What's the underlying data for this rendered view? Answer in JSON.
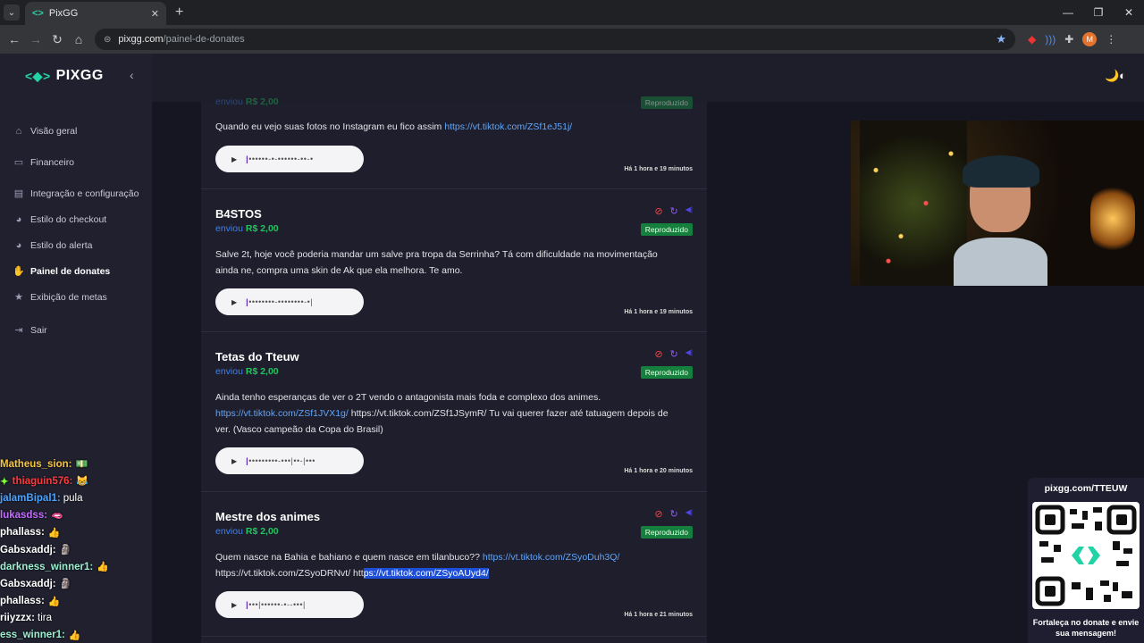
{
  "browser": {
    "tab_title": "PixGG",
    "url_domain": "pixgg.com",
    "url_path": "/painel-de-donates",
    "profile_initial": "M"
  },
  "sidebar": {
    "logo": "PIXGG",
    "items": [
      {
        "label": "Visão geral",
        "icon": "home-icon"
      },
      {
        "label": "Financeiro",
        "icon": "wallet-icon"
      },
      {
        "label": "Integração e configuração",
        "icon": "settings-icon"
      },
      {
        "label": "Estilo do checkout",
        "icon": "palette-icon"
      },
      {
        "label": "Estilo do alerta",
        "icon": "palette-icon"
      },
      {
        "label": "Painel de donates",
        "icon": "donate-icon",
        "active": true
      },
      {
        "label": "Exibição de metas",
        "icon": "star-icon"
      },
      {
        "label": "Sair",
        "icon": "logout-icon"
      }
    ]
  },
  "donations": [
    {
      "name": "",
      "sent_label": "enviou",
      "amount": "R$ 2,00",
      "message_parts": [
        {
          "text": "Quando eu vejo suas fotos no Instagram eu fico assim "
        },
        {
          "link": "https://vt.tiktok.com/ZSf1eJ51j/"
        }
      ],
      "time": "Há 1 hora e 19 minutos",
      "status": "Reproduzido"
    },
    {
      "name": "B4STOS",
      "sent_label": "enviou",
      "amount": "R$ 2,00",
      "message_parts": [
        {
          "text": "Salve 2t, hoje você poderia mandar um salve pra tropa da Serrinha? Tá com dificuldade na movimentação ainda ne, compra uma skin de Ak que ela melhora. Te amo."
        }
      ],
      "time": "Há 1 hora e 19 minutos",
      "status": "Reproduzido"
    },
    {
      "name": "Tetas do Tteuw",
      "sent_label": "enviou",
      "amount": "R$ 2,00",
      "message_parts": [
        {
          "text": "Ainda tenho esperanças de ver o 2T vendo o antagonista mais foda e complexo dos animes. "
        },
        {
          "link": "https://vt.tiktok.com/ZSf1JVX1g/"
        },
        {
          "text": " https://vt.tiktok.com/ZSf1JSymR/ Tu vai querer fazer até tatuagem depois de ver. (Vasco campeão da Copa do Brasil)"
        }
      ],
      "time": "Há 1 hora e 20 minutos",
      "status": "Reproduzido"
    },
    {
      "name": "Mestre dos animes",
      "sent_label": "enviou",
      "amount": "R$ 2,00",
      "message_parts": [
        {
          "text": "Quem nasce na Bahia e bahiano e quem nasce em tilanbuco?? "
        },
        {
          "link": "https://vt.tiktok.com/ZSyoDuh3Q/"
        },
        {
          "text": " https://vt.tiktok.com/ZSyoDRNvt/ htt"
        },
        {
          "sel": "ps://vt.tiktok.com/ZSyoAUyd4/"
        }
      ],
      "time": "Há 1 hora e 21 minutos",
      "status": "Reproduzido"
    }
  ],
  "chat": [
    {
      "user": "Matheus_sion:",
      "color": "#f5c542",
      "emote": "💵",
      "text": ""
    },
    {
      "user": "thiaguin576:",
      "color": "#ff3b3b",
      "emote": "😹",
      "text": "",
      "prefix": "✦"
    },
    {
      "user": "jalamBipal1:",
      "color": "#4aa3ff",
      "emote": "",
      "text": "pula"
    },
    {
      "user": "lukasdss:",
      "color": "#c46cff",
      "emote": "🫦",
      "text": ""
    },
    {
      "user": "phallass:",
      "color": "#ffffff",
      "emote": "👍",
      "text": ""
    },
    {
      "user": "Gabsxaddj:",
      "color": "#ffffff",
      "emote": "🗿",
      "text": ""
    },
    {
      "user": "darkness_winner1:",
      "color": "#9cf0d0",
      "emote": "👍",
      "text": ""
    },
    {
      "user": "Gabsxaddj:",
      "color": "#ffffff",
      "emote": "🗿",
      "text": ""
    },
    {
      "user": "phallass:",
      "color": "#ffffff",
      "emote": "👍",
      "text": ""
    },
    {
      "user": "riiyzzx:",
      "color": "#ffffff",
      "emote": "",
      "text": "tira"
    },
    {
      "user": "ess_winner1:",
      "color": "#9cf0d0",
      "emote": "👍",
      "text": ""
    }
  ],
  "qr_panel": {
    "title": "pixgg.com/TTEUW",
    "caption": "Fortaleça no donate e envie sua mensagem!"
  },
  "colors": {
    "accent": "#22d3a6",
    "amount": "#22c55e",
    "sent": "#3b82f6",
    "badge": "#15803d"
  }
}
